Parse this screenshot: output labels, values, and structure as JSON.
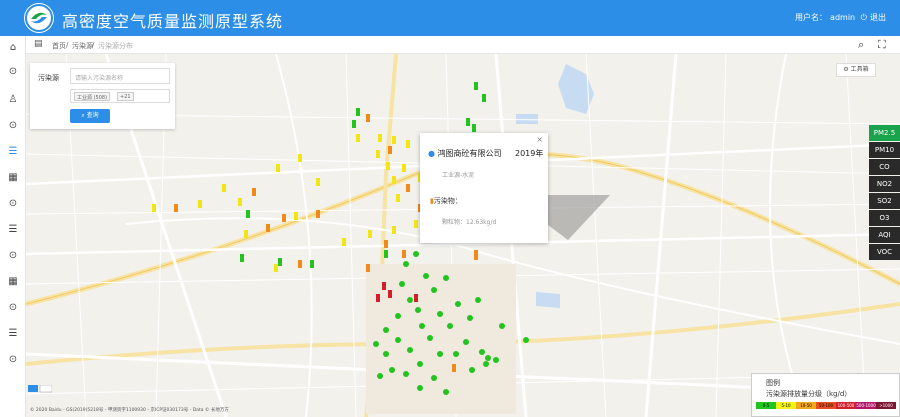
{
  "header": {
    "title": "高密度空气质量监测原型系统",
    "user_label": "用户名：",
    "user_name": "admin",
    "logout": "退出"
  },
  "breadcrumb": {
    "items": [
      "首页",
      "污染源",
      "污染源分布"
    ]
  },
  "search_panel": {
    "label": "污染源",
    "placeholder": "请输入污染源名称",
    "tags": [
      "工业源 (508)",
      "+21"
    ],
    "button": "查询"
  },
  "layer_button": "工具箱",
  "popup": {
    "company": "鸿图商砼有限公司",
    "year": "2019年",
    "industry": "工业源-水泥",
    "pollutant_title": "污染物：",
    "pollutant_value": "颗粒物：12.63kg/d"
  },
  "pollutants": [
    "PM2.5",
    "PM10",
    "CO",
    "NO2",
    "SO2",
    "O3",
    "AQI",
    "VOC"
  ],
  "legend": {
    "title": "图例",
    "subtitle": "污染源排放量分级（kg/d）",
    "segments": [
      {
        "label": "0-5",
        "color": "#22c41e"
      },
      {
        "label": "5-10",
        "color": "#f2f215"
      },
      {
        "label": "10-50",
        "color": "#f2a818"
      },
      {
        "label": "50-100",
        "color": "#e84e1b"
      },
      {
        "label": "100-500",
        "color": "#d3202a"
      },
      {
        "label": "500-1000",
        "color": "#b3176c"
      },
      {
        "label": ">1000",
        "color": "#7a1630"
      }
    ]
  },
  "colors": {
    "accent": "#2c8ee6",
    "green": "#22c41e",
    "yellow": "#f2e515",
    "orange": "#f08a1a",
    "red": "#d3202a"
  },
  "copyright": "© 2020 Baidu - GS(2019)5218号 - 甲测资字1100930 - 京ICP证030173号 - Data © 长地万方"
}
